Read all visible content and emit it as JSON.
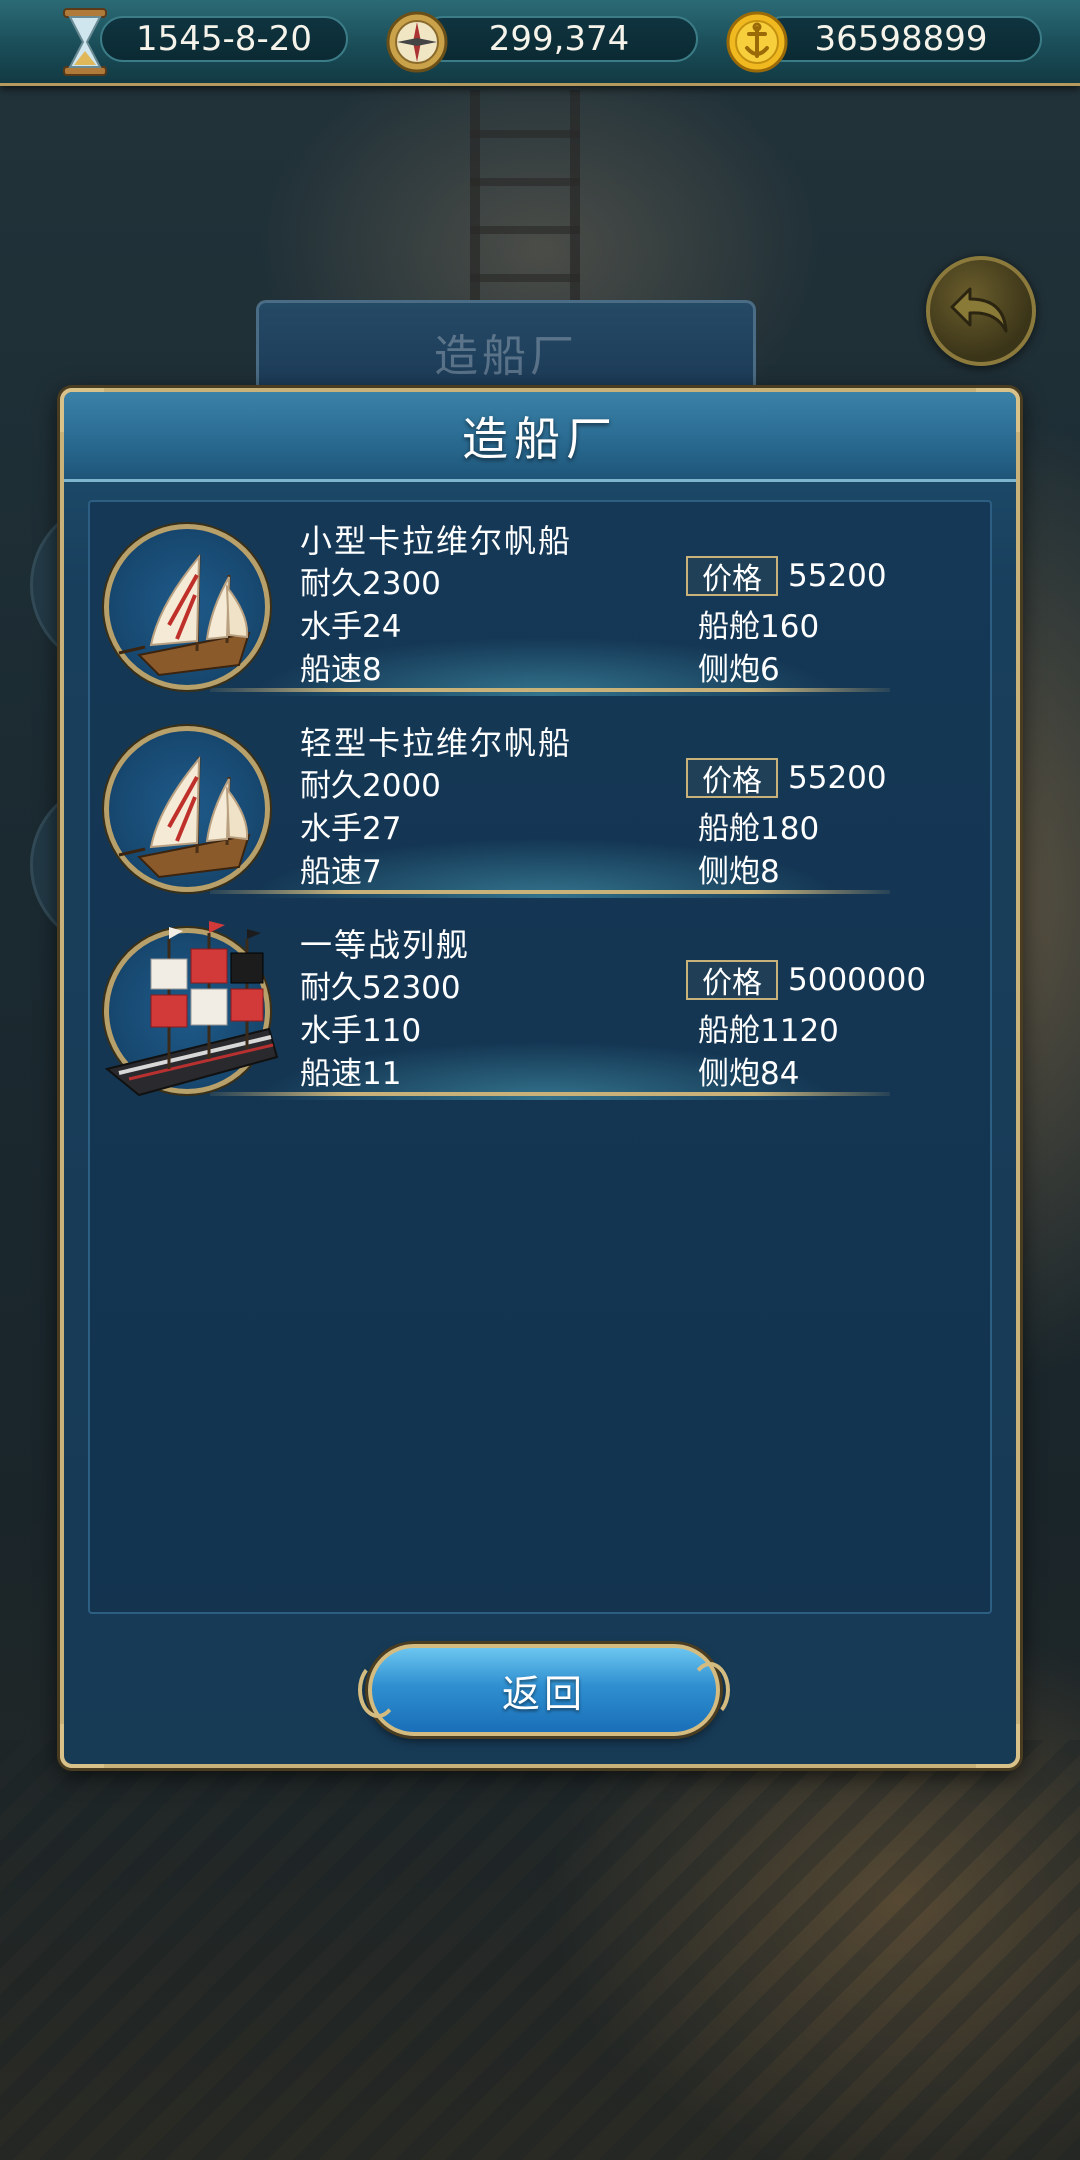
{
  "status_bar": {
    "date": "1545-8-20",
    "compass_value": "299,374",
    "gold": "36598899",
    "icons": [
      "hourglass-icon",
      "compass-icon",
      "gold-coin-icon"
    ]
  },
  "background": {
    "faded_tab_title": "造船厂"
  },
  "panel": {
    "title": "造船厂",
    "price_label": "价格",
    "stat_labels": {
      "durability": "耐久",
      "crew": "水手",
      "speed": "船速",
      "cabin": "船舱",
      "cannons": "侧炮"
    },
    "ships": [
      {
        "name": "小型卡拉维尔帆船",
        "durability": "2300",
        "crew": "24",
        "speed": "8",
        "price": "55200",
        "cabin": "160",
        "cannons": "6"
      },
      {
        "name": "轻型卡拉维尔帆船",
        "durability": "2000",
        "crew": "27",
        "speed": "7",
        "price": "55200",
        "cabin": "180",
        "cannons": "8"
      },
      {
        "name": "一等战列舰",
        "durability": "52300",
        "crew": "110",
        "speed": "11",
        "price": "5000000",
        "cabin": "1120",
        "cannons": "84"
      }
    ],
    "return_button": "返回"
  },
  "colors": {
    "gold_trim": "#c9b27a",
    "panel_blue": "#183f5c",
    "button_blue": "#2f8fd0"
  }
}
